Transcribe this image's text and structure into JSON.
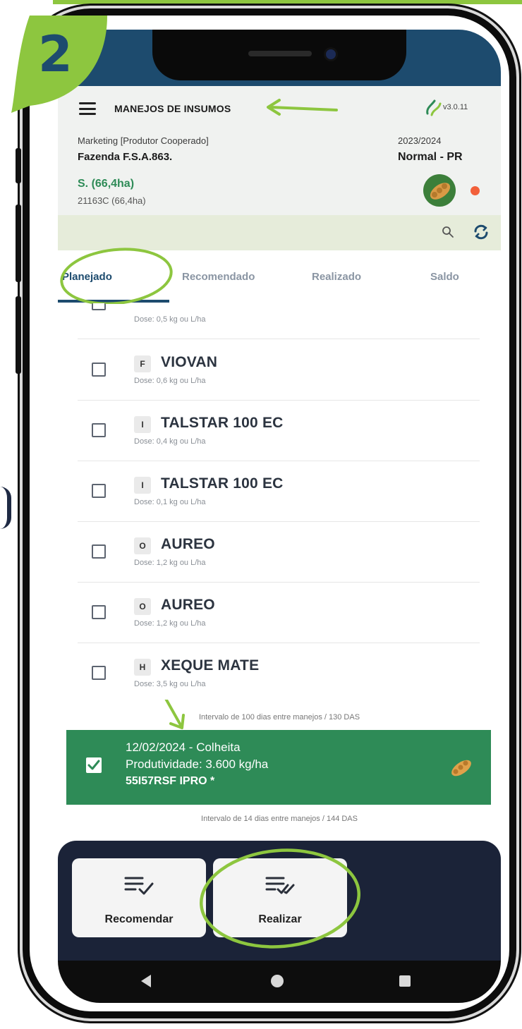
{
  "header": {
    "title": "MANEJOS DE INSUMOS",
    "version": "v3.0.11",
    "company": "Marketing [Produtor Cooperado]",
    "farm": "Fazenda F.S.A.863.",
    "harvest": "2023/2024",
    "region": "Normal - PR",
    "field_name": "S. (66,4ha)",
    "field_code": "21163C (66,4ha)"
  },
  "step": {
    "number": "2"
  },
  "tabs": [
    {
      "label": "Planejado",
      "active": true
    },
    {
      "label": "Recomendado",
      "active": false
    },
    {
      "label": "Realizado",
      "active": false
    },
    {
      "label": "Saldo",
      "active": false
    }
  ],
  "items": [
    {
      "badge": "",
      "name": "",
      "dose": "Dose: 0,5 kg ou L/ha",
      "checked": false
    },
    {
      "badge": "F",
      "name": "VIOVAN",
      "dose": "Dose: 0,6 kg ou L/ha",
      "checked": false
    },
    {
      "badge": "I",
      "name": "TALSTAR 100 EC",
      "dose": "Dose: 0,4 kg ou L/ha",
      "checked": false
    },
    {
      "badge": "I",
      "name": "TALSTAR 100 EC",
      "dose": "Dose: 0,1 kg ou L/ha",
      "checked": false
    },
    {
      "badge": "O",
      "name": "AUREO",
      "dose": "Dose: 1,2 kg ou L/ha",
      "checked": false
    },
    {
      "badge": "O",
      "name": "AUREO",
      "dose": "Dose: 1,2 kg ou L/ha",
      "checked": false
    },
    {
      "badge": "H",
      "name": "XEQUE MATE",
      "dose": "Dose: 3,5 kg ou L/ha",
      "checked": false
    }
  ],
  "intervals": {
    "first": "Intervalo de 100 dias entre manejos / 130 DAS",
    "second": "Intervalo de 14 dias entre manejos / 144 DAS"
  },
  "event": {
    "date_line": "12/02/2024 - Colheita",
    "productivity": "Produtividade: 3.600 kg/ha",
    "variety": "55I57RSF IPRO *",
    "checked": true
  },
  "actions": {
    "recommend_label": "Recomendar",
    "execute_label": "Realizar"
  },
  "colors": {
    "brand_blue": "#1d4b6e",
    "green": "#2e8b57",
    "highlight": "#8dc63f",
    "dark_panel": "#1b2338",
    "status_dot": "#f2603a"
  },
  "icons": [
    "menu-icon",
    "logo-icon",
    "search-icon",
    "refresh-icon",
    "checkbox-icon",
    "seed-icon",
    "list-check-icon",
    "list-double-check-icon",
    "back-icon",
    "home-icon",
    "recents-icon"
  ]
}
